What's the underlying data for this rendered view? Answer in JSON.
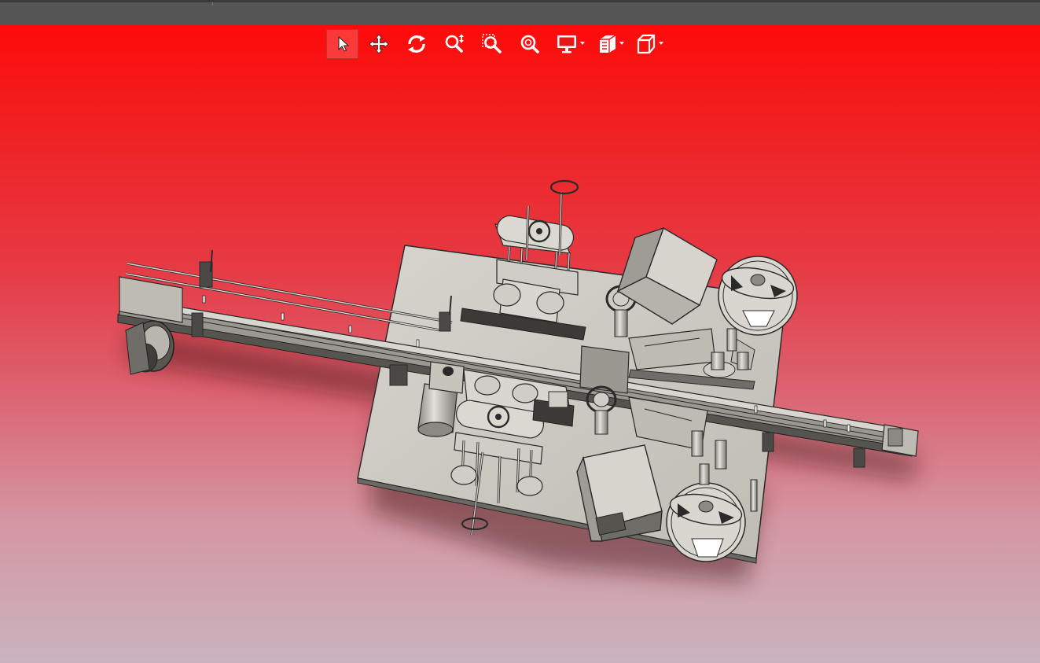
{
  "window": {
    "titlebar_color": "#555555"
  },
  "viewport": {
    "background_top": "#ff0a0a",
    "background_bottom": "#c9b4be"
  },
  "toolbar": {
    "tools": [
      {
        "id": "select",
        "icon": "pointer-arrow-icon",
        "active": true,
        "dropdown": false
      },
      {
        "id": "pan",
        "icon": "pan-move-icon",
        "active": false,
        "dropdown": false
      },
      {
        "id": "rotate",
        "icon": "rotate-icon",
        "active": false,
        "dropdown": false
      },
      {
        "id": "zoom-in-out",
        "icon": "zoom-in-out-icon",
        "active": false,
        "dropdown": false
      },
      {
        "id": "zoom-to-area",
        "icon": "zoom-area-icon",
        "active": false,
        "dropdown": false
      },
      {
        "id": "zoom-to-fit",
        "icon": "zoom-fit-icon",
        "active": false,
        "dropdown": false
      },
      {
        "id": "display-style",
        "icon": "monitor-icon",
        "active": false,
        "dropdown": true
      },
      {
        "id": "section-view",
        "icon": "section-view-icon",
        "active": false,
        "dropdown": true
      },
      {
        "id": "view-orientation",
        "icon": "cube-view-icon",
        "active": false,
        "dropdown": true
      }
    ]
  },
  "model": {
    "description_icon": "labeling-machine-3d-model",
    "part_color": "#c8c6bd",
    "edge_color": "#2a2a2a",
    "dark_part_color": "#6e6d68"
  }
}
